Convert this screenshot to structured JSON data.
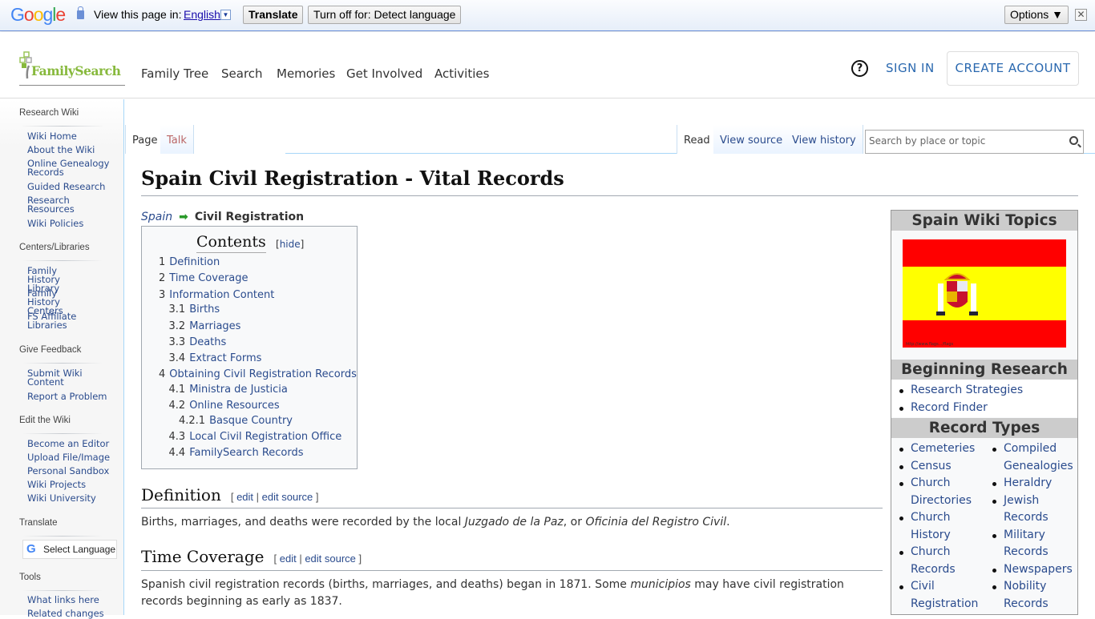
{
  "translate_bar": {
    "google_logo": "Google",
    "lock_icon": "lock-icon",
    "view_text": "View this page in:",
    "language": "English",
    "translate_button": "Translate",
    "turn_off_button": "Turn off for: Detect language",
    "options_button": "Options ▼",
    "close": "✕"
  },
  "header": {
    "logo_text": "FamilySearch",
    "nav": [
      "Family Tree",
      "Search",
      "Memories",
      "Get Involved",
      "Activities"
    ],
    "help": "?",
    "sign_in": "SIGN IN",
    "create_account": "CREATE ACCOUNT"
  },
  "sidebar": {
    "sections": [
      {
        "heading": "Research Wiki",
        "items": [
          "Wiki Home",
          "About the Wiki",
          "Online Genealogy Records",
          "Guided Research",
          "Research Resources",
          "Wiki Policies"
        ]
      },
      {
        "heading": "Centers/Libraries",
        "items": [
          "Family History Library",
          "Family History Centers",
          "FS Affiliate Libraries"
        ]
      },
      {
        "heading": "Give Feedback",
        "items": [
          "Submit Wiki Content",
          "Report a Problem"
        ]
      },
      {
        "heading": "Edit the Wiki",
        "items": [
          "Become an Editor",
          "Upload File/Image",
          "Personal Sandbox",
          "Wiki Projects",
          "Wiki University"
        ]
      },
      {
        "heading": "Translate",
        "select_language": "Select Language"
      },
      {
        "heading": "Tools",
        "items": [
          "What links here",
          "Related changes"
        ]
      }
    ]
  },
  "tabs": {
    "left": [
      "Page",
      "Talk"
    ],
    "right": [
      "Read",
      "View source",
      "View history"
    ],
    "search_placeholder": "Search by place or topic"
  },
  "page": {
    "title": "Spain Civil Registration - Vital Records",
    "breadcrumb": {
      "parent": "Spain",
      "current": "Civil Registration"
    },
    "toc": {
      "title": "Contents",
      "hide": "hide",
      "items": [
        {
          "num": "1",
          "text": "Definition",
          "level": 1
        },
        {
          "num": "2",
          "text": "Time Coverage",
          "level": 1
        },
        {
          "num": "3",
          "text": "Information Content",
          "level": 1
        },
        {
          "num": "3.1",
          "text": "Births",
          "level": 2
        },
        {
          "num": "3.2",
          "text": "Marriages",
          "level": 2
        },
        {
          "num": "3.3",
          "text": "Deaths",
          "level": 2
        },
        {
          "num": "3.4",
          "text": "Extract Forms",
          "level": 2
        },
        {
          "num": "4",
          "text": "Obtaining Civil Registration Records",
          "level": 1
        },
        {
          "num": "4.1",
          "text": "Ministra de Justicia",
          "level": 2
        },
        {
          "num": "4.2",
          "text": "Online Resources",
          "level": 2
        },
        {
          "num": "4.2.1",
          "text": "Basque Country",
          "level": 3
        },
        {
          "num": "4.3",
          "text": "Local Civil Registration Office",
          "level": 2
        },
        {
          "num": "4.4",
          "text": "FamilySearch Records",
          "level": 2
        }
      ]
    },
    "sections": [
      {
        "heading": "Definition",
        "edit": "edit",
        "edit_source": "edit source",
        "text_parts": [
          "Births, marriages, and deaths were recorded by the local ",
          "Juzgado de la Paz",
          ", or ",
          "Oficinia del Registro Civil",
          "."
        ]
      },
      {
        "heading": "Time Coverage",
        "edit": "edit",
        "edit_source": "edit source",
        "text_parts": [
          "Spanish civil registration records (births, marriages, and deaths) began in 1871. Some ",
          "municipios",
          " may have civil registration records beginning as early as 1837."
        ]
      }
    ]
  },
  "infobox": {
    "title": "Spain Wiki Topics",
    "flag": "spain-flag",
    "flag_colors": {
      "red": "#ff0000",
      "yellow": "#ffff00"
    },
    "beginning_heading": "Beginning Research",
    "beginning_items": [
      "Research Strategies",
      "Record Finder"
    ],
    "record_types_heading": "Record Types",
    "record_types_col1": [
      "Cemeteries",
      "Census",
      "Church Directories",
      "Church History",
      "Church Records",
      "Civil Registration"
    ],
    "record_types_col2": [
      "Compiled Genealogies",
      "Heraldry",
      "Jewish Records",
      "Military Records",
      "Newspapers",
      "Nobility Records"
    ]
  },
  "colors": {
    "link": "#2a4b8d",
    "accent_blue": "#2a68af",
    "logo_green": "#87b93c"
  }
}
